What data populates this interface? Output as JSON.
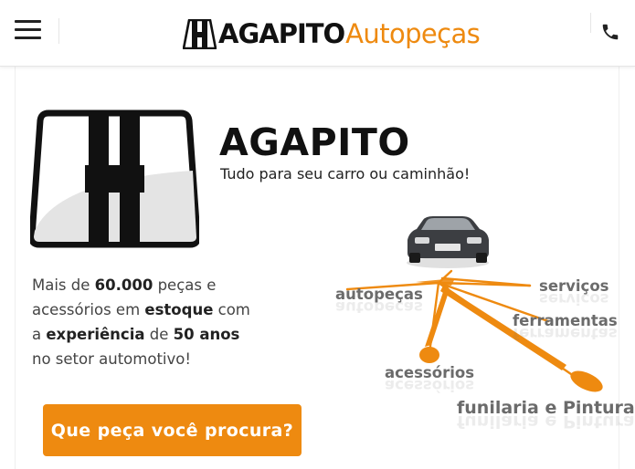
{
  "header": {
    "brand_name": "AGAPITO",
    "brand_sub": "Autopeças"
  },
  "hero": {
    "title": "AGAPITO",
    "tagline": "Tudo para seu carro ou caminhão!"
  },
  "description": {
    "p1": "Mais de ",
    "b1": "60.000",
    "p2": " peças e acessórios em ",
    "b2": "estoque",
    "p3": " com a ",
    "b3": "experiência",
    "p4": " de ",
    "b4": "50 anos",
    "p5": " no setor automotivo!"
  },
  "cta": {
    "label": "Que peça você procura?"
  },
  "categories": {
    "autopecas": "autopeças",
    "servicos": "serviços",
    "ferramentas": "ferramentas",
    "acessorios": "acessórios",
    "funilaria": "funilaria e Pintura"
  },
  "colors": {
    "accent": "#ee8a10",
    "text_dark": "#111111",
    "category_gray": "#6b6b6b"
  },
  "icons": {
    "menu": "hamburger-icon",
    "phone": "phone-icon",
    "logo": "agapito-h-logo",
    "car": "car-icon"
  }
}
